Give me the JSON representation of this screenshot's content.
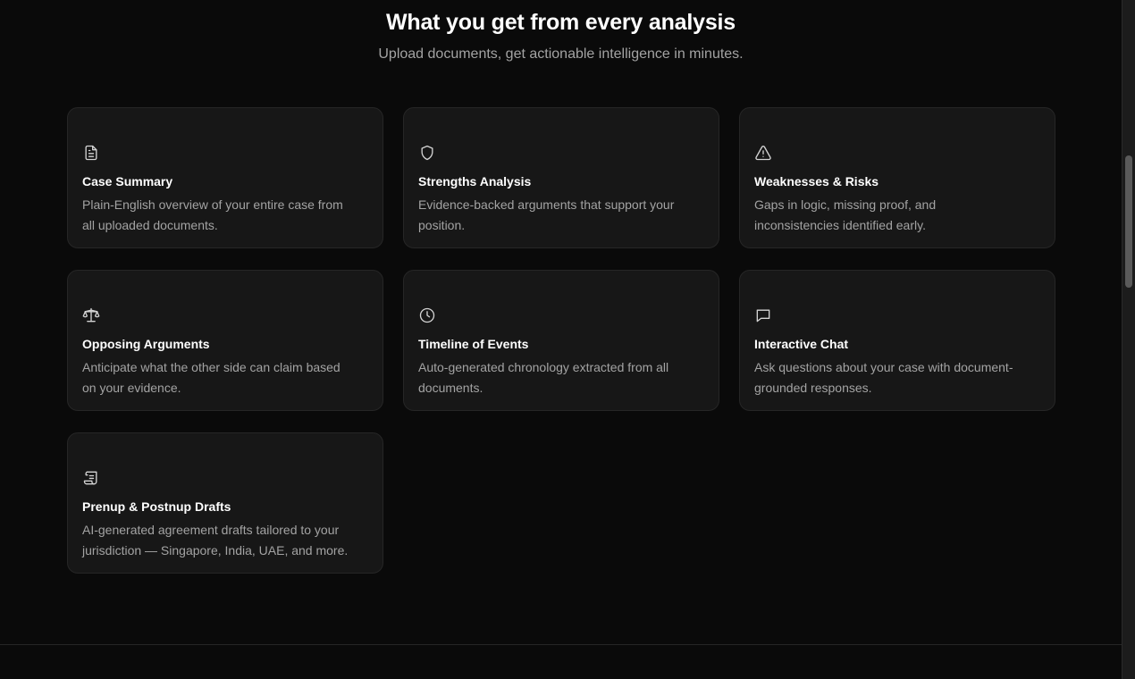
{
  "section": {
    "title": "What you get from every analysis",
    "subtitle": "Upload documents, get actionable intelligence in minutes."
  },
  "features": [
    {
      "icon": "document-icon",
      "title": "Case Summary",
      "description": "Plain-English overview of your entire case from all uploaded documents."
    },
    {
      "icon": "shield-icon",
      "title": "Strengths Analysis",
      "description": "Evidence-backed arguments that support your position."
    },
    {
      "icon": "warning-triangle-icon",
      "title": "Weaknesses & Risks",
      "description": "Gaps in logic, missing proof, and inconsistencies identified early."
    },
    {
      "icon": "scales-icon",
      "title": "Opposing Arguments",
      "description": "Anticipate what the other side can claim based on your evidence."
    },
    {
      "icon": "clock-icon",
      "title": "Timeline of Events",
      "description": "Auto-generated chronology extracted from all documents."
    },
    {
      "icon": "chat-bubble-icon",
      "title": "Interactive Chat",
      "description": "Ask questions about your case with document-grounded responses."
    },
    {
      "icon": "scroll-icon",
      "title": "Prenup & Postnup Drafts",
      "description": "AI-generated agreement drafts tailored to your jurisdiction — Singapore, India, UAE, and more."
    }
  ],
  "colors": {
    "background": "#0a0a0a",
    "card": "#171717",
    "card_border": "#262626",
    "title_text": "#ffffff",
    "muted_text": "#a3a3a3"
  }
}
